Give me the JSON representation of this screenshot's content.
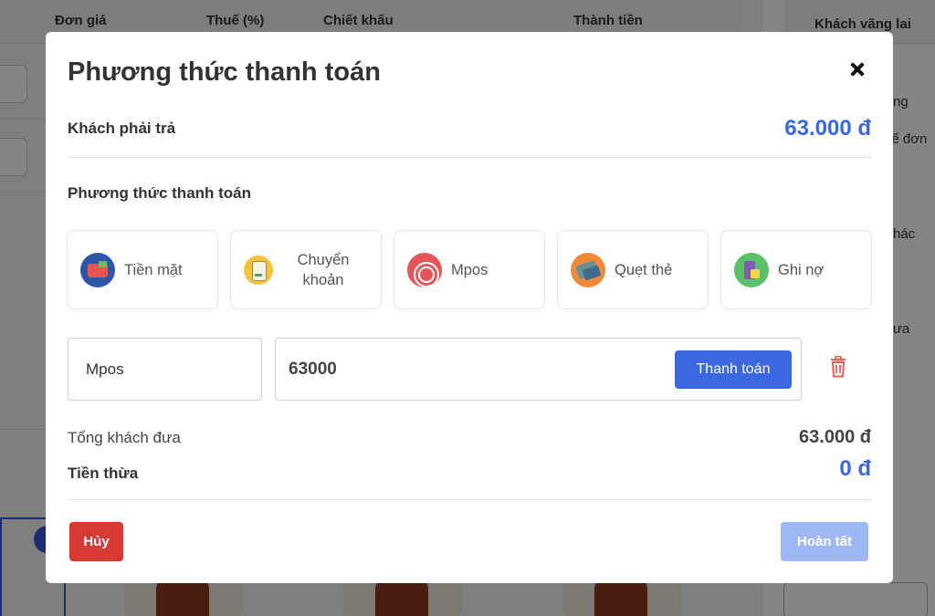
{
  "background": {
    "columns": [
      "Đơn giá",
      "Thuế (%)",
      "Chiết khấu",
      "Thành tiền"
    ],
    "right_panel": {
      "tab_label": "Khách vãng lai",
      "fragments": [
        "ng",
        "uế đơn",
        "hác",
        "ưa"
      ]
    }
  },
  "modal": {
    "title": "Phương thức thanh toán",
    "amount_due_label": "Khách phải trả",
    "amount_due_value": "63.000 đ",
    "methods_label": "Phương thức thanh toán",
    "methods": [
      {
        "label": "Tiền mặt",
        "icon": "wallet-icon"
      },
      {
        "label": "Chuyển khoản",
        "icon": "bank-transfer-icon"
      },
      {
        "label": "Mpos",
        "icon": "mpos-icon"
      },
      {
        "label": "Quẹt thẻ",
        "icon": "card-swipe-icon"
      },
      {
        "label": "Ghi nợ",
        "icon": "debt-icon"
      }
    ],
    "payment_row": {
      "method": "Mpos",
      "amount_value": "63000",
      "pay_label": "Thanh toán"
    },
    "total_paid_label": "Tổng khách đưa",
    "total_paid_value": "63.000 đ",
    "change_label": "Tiền thừa",
    "change_value": "0 đ",
    "cancel_label": "Hủy",
    "finish_label": "Hoàn tất"
  },
  "colors": {
    "primary": "#3b68e0",
    "danger": "#d63a32",
    "disabled_primary": "#9fb7f3"
  }
}
